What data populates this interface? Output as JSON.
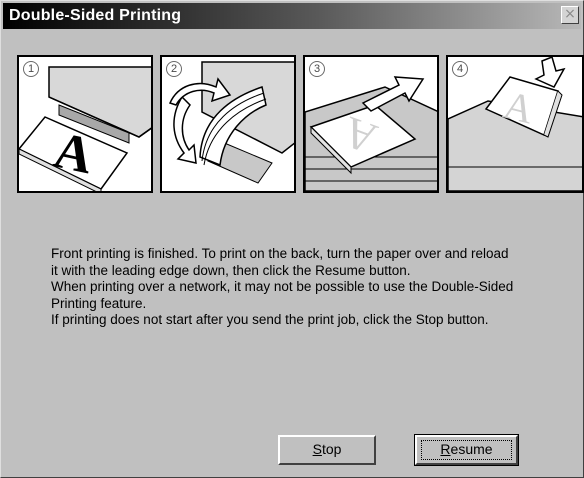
{
  "window": {
    "title": "Double-Sided Printing",
    "close_glyph": "×"
  },
  "steps": [
    {
      "number": "1",
      "icon": "printer-printed-sheet-icon"
    },
    {
      "number": "2",
      "icon": "flip-paper-icon"
    },
    {
      "number": "3",
      "icon": "remove-paper-icon"
    },
    {
      "number": "4",
      "icon": "reload-paper-icon"
    }
  ],
  "message": {
    "line1": "Front printing is finished. To print on the back, turn the paper over and reload",
    "line2": "it with the leading edge down, then click the Resume button.",
    "line3": "When printing over a network, it may not be possible to use the Double-Sided",
    "line4": "Printing feature.",
    "line5": "If printing does not start after you send the print job, click the Stop button."
  },
  "buttons": {
    "stop": {
      "mnemonic": "S",
      "rest": "top"
    },
    "resume": {
      "mnemonic": "R",
      "rest": "esume"
    }
  },
  "colors": {
    "dialog_bg": "#c0c0c0",
    "title_start": "#000000",
    "title_end": "#b8b8b8"
  }
}
